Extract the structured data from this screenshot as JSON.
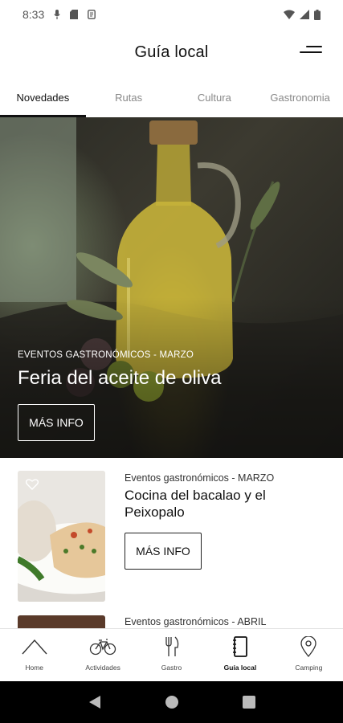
{
  "status": {
    "time": "8:33"
  },
  "header": {
    "title": "Guía local"
  },
  "tabs": [
    {
      "label": "Novedades",
      "active": true
    },
    {
      "label": "Rutas",
      "active": false
    },
    {
      "label": "Cultura",
      "active": false
    },
    {
      "label": "Gastronomia",
      "active": false
    }
  ],
  "hero": {
    "category": "EVENTOS GASTRONÓMICOS - MARZO",
    "title": "Feria del aceite de oliva",
    "button_label": "MÁS INFO"
  },
  "cards": [
    {
      "category": "Eventos gastronómicos - MARZO",
      "title": "Cocina del bacalao y el Peixopalo",
      "button_label": "MÁS INFO"
    },
    {
      "category": "Eventos gastronómicos - ABRIL"
    }
  ],
  "bottom_nav": [
    {
      "label": "Home",
      "icon": "home-icon",
      "active": false
    },
    {
      "label": "Actividades",
      "icon": "bicycle-icon",
      "active": false
    },
    {
      "label": "Gastro",
      "icon": "fork-knife-icon",
      "active": false
    },
    {
      "label": "Guía local",
      "icon": "notebook-icon",
      "active": true
    },
    {
      "label": "Camping",
      "icon": "location-pin-icon",
      "active": false
    }
  ],
  "colors": {
    "accent": "#111111",
    "inactive_tab": "#888888",
    "divider": "#e2e2e2"
  }
}
